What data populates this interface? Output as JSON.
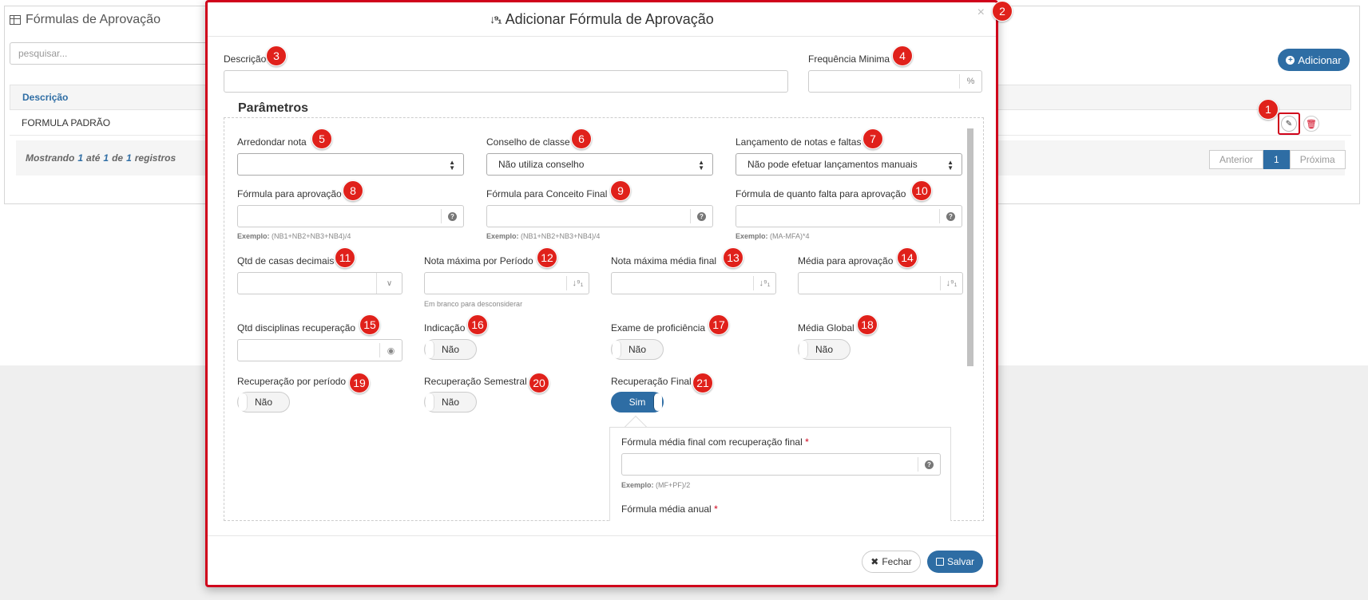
{
  "background": {
    "page_title": "Fórmulas de Aprovação",
    "search_placeholder": "pesquisar...",
    "add_button": "Adicionar",
    "table": {
      "column_header": "Descrição",
      "rows": [
        "FORMULA PADRÃO"
      ],
      "footer": {
        "prefix": "Mostrando",
        "from": "1",
        "until_word": "até",
        "to": "1",
        "of_word": "de",
        "total": "1",
        "suffix": "registros"
      }
    },
    "pagination": {
      "prev": "Anterior",
      "current": "1",
      "next": "Próxima"
    }
  },
  "modal": {
    "title": "Adicionar Fórmula de Aprovação",
    "close_glyph": "×",
    "descricao_label": "Descrição",
    "freq_label": "Frequência Minima",
    "freq_suffix": "%",
    "legend": "Parâmetros",
    "arredondar_label": "Arredondar nota",
    "arredondar_value": "",
    "conselho_label": "Conselho de classe",
    "conselho_value": "Não utiliza conselho",
    "lancamento_label": "Lançamento de notas e faltas",
    "lancamento_value": "Não pode efetuar lançamentos manuais",
    "formula_aprov_label": "Fórmula para aprovação",
    "formula_aprov_example_label": "Exemplo:",
    "formula_aprov_example": "(NB1+NB2+NB3+NB4)/4",
    "formula_conceito_label": "Fórmula para Conceito Final",
    "formula_conceito_example_label": "Exemplo:",
    "formula_conceito_example": "(NB1+NB2+NB3+NB4)/4",
    "formula_falta_label": "Fórmula de quanto falta para aprovação",
    "formula_falta_example_label": "Exemplo:",
    "formula_falta_example": "(MA-MFA)*4",
    "casas_label": "Qtd de casas decimais",
    "nota_max_periodo_label": "Nota máxima por Período",
    "nota_max_periodo_help": "Em branco para desconsiderar",
    "nota_max_media_label": "Nota máxima média final",
    "media_aprov_label": "Média para aprovação",
    "qtd_disc_label": "Qtd disciplinas recuperação",
    "indicacao_label": "Indicação",
    "indicacao_value": "Não",
    "exame_label": "Exame de proficiência",
    "exame_value": "Não",
    "media_global_label": "Média Global",
    "media_global_value": "Não",
    "rec_periodo_label": "Recuperação por período",
    "rec_periodo_value": "Não",
    "rec_semestral_label": "Recuperação Semestral",
    "rec_semestral_value": "Não",
    "rec_final_label": "Recuperação Final",
    "rec_final_value": "Sim",
    "formula_media_final_rec_label": "Fórmula média final com recuperação final",
    "formula_media_final_rec_example_label": "Exemplo:",
    "formula_media_final_rec_example": "(MF+PF)/2",
    "formula_media_anual_label": "Fórmula média anual",
    "required_mark": "*",
    "close_button": "Fechar",
    "save_button": "Salvar"
  },
  "badges": [
    "1",
    "2",
    "3",
    "4",
    "5",
    "6",
    "7",
    "8",
    "9",
    "10",
    "11",
    "12",
    "13",
    "14",
    "15",
    "16",
    "17",
    "18",
    "19",
    "20",
    "21"
  ],
  "colors": {
    "primary": "#2e6da4",
    "annotation": "#e0211b",
    "highlight_border": "#d0021b"
  },
  "icons": {
    "table": "table-icon",
    "plus": "plus-circle-icon",
    "edit": "edit-icon",
    "delete": "trash-icon",
    "sort": "sort-numeric-icon",
    "help": "question-circle-icon",
    "close": "close-icon",
    "cubes": "cubes-icon",
    "save": "save-icon"
  }
}
